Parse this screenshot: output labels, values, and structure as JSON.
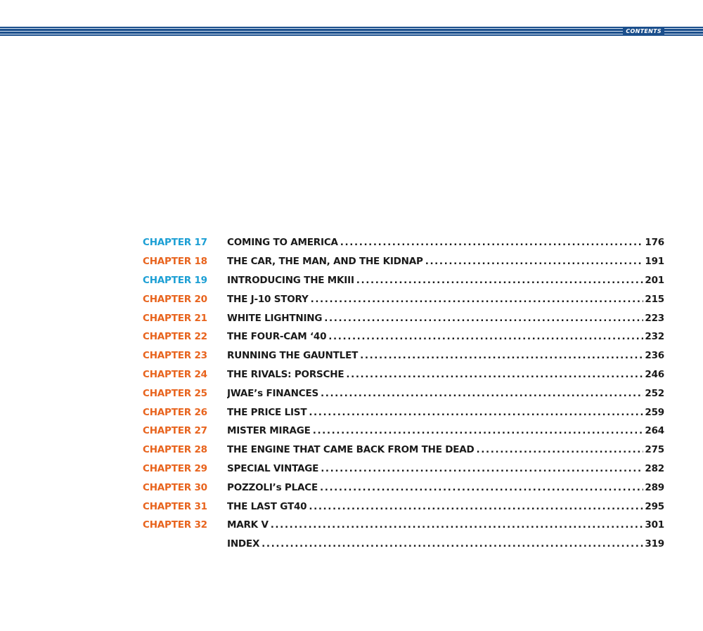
{
  "header": {
    "section_label": "CONTENTS"
  },
  "colors": {
    "band": "#1b4f8c",
    "chapter_orange": "#e8641e",
    "chapter_blue": "#1c9fd4",
    "text": "#1a1a1a"
  },
  "toc": [
    {
      "chapter": "CHAPTER 17",
      "color": "blue",
      "title": "COMING TO AMERICA",
      "page": "176"
    },
    {
      "chapter": "CHAPTER 18",
      "color": "orange",
      "title": "THE CAR, THE MAN, AND THE KIDNAP",
      "page": "191"
    },
    {
      "chapter": "CHAPTER 19",
      "color": "blue",
      "title": "INTRODUCING THE MKIII",
      "page": "201"
    },
    {
      "chapter": "CHAPTER 20",
      "color": "orange",
      "title": "THE J-10 STORY",
      "page": "215"
    },
    {
      "chapter": "CHAPTER 21",
      "color": "orange",
      "title": "WHITE LIGHTNING",
      "page": "223"
    },
    {
      "chapter": "CHAPTER 22",
      "color": "orange",
      "title": "THE FOUR-CAM ‘40",
      "page": "232"
    },
    {
      "chapter": "CHAPTER 23",
      "color": "orange",
      "title": "RUNNING THE GAUNTLET",
      "page": "236"
    },
    {
      "chapter": "CHAPTER 24",
      "color": "orange",
      "title": "THE RIVALS: PORSCHE",
      "page": "246"
    },
    {
      "chapter": "CHAPTER 25",
      "color": "orange",
      "title": "JWAE’s FINANCES",
      "page": "252"
    },
    {
      "chapter": "CHAPTER 26",
      "color": "orange",
      "title": "THE PRICE LIST",
      "page": "259"
    },
    {
      "chapter": "CHAPTER 27",
      "color": "orange",
      "title": "MISTER MIRAGE",
      "page": "264"
    },
    {
      "chapter": "CHAPTER 28",
      "color": "orange",
      "title": "THE ENGINE THAT CAME BACK FROM THE DEAD",
      "page": "275"
    },
    {
      "chapter": "CHAPTER 29",
      "color": "orange",
      "title": "SPECIAL VINTAGE",
      "page": "282"
    },
    {
      "chapter": "CHAPTER 30",
      "color": "orange",
      "title": "POZZOLI’s PLACE",
      "page": "289"
    },
    {
      "chapter": "CHAPTER 31",
      "color": "orange",
      "title": "THE LAST GT40",
      "page": "295"
    },
    {
      "chapter": "CHAPTER 32",
      "color": "orange",
      "title": "MARK V",
      "page": "301"
    },
    {
      "chapter": "",
      "color": "orange",
      "title": "INDEX",
      "page": "319"
    }
  ]
}
